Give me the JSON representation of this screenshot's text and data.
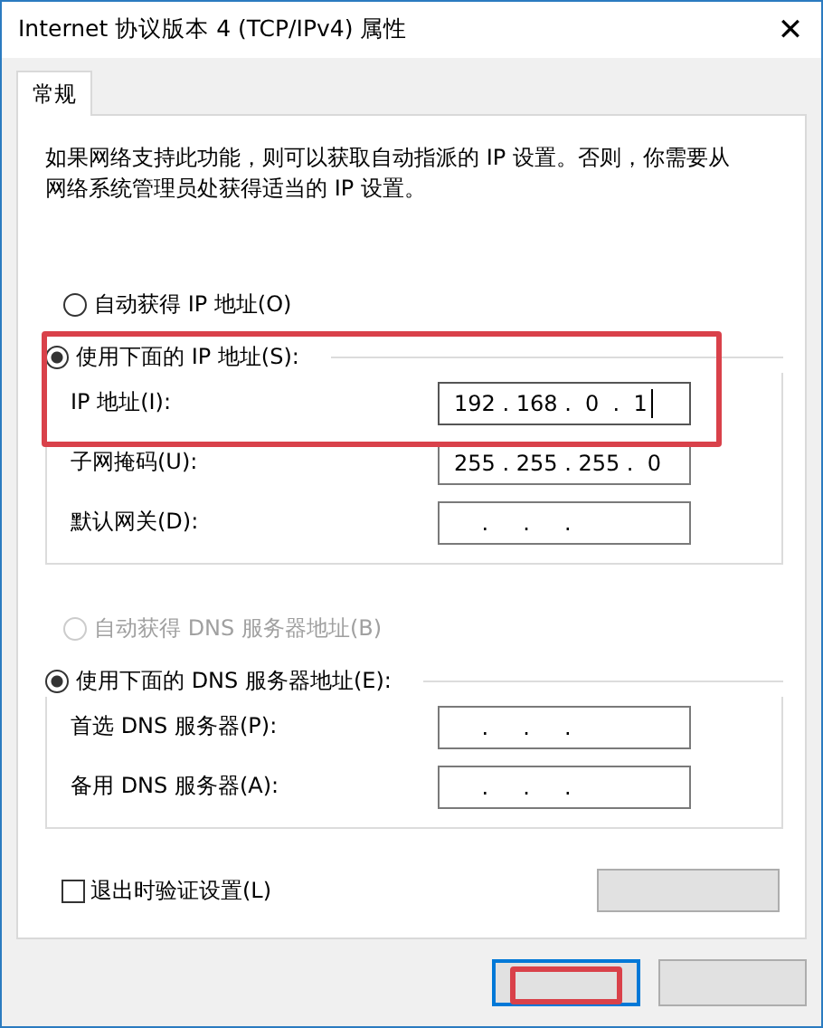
{
  "window": {
    "title": "Internet 协议版本 4 (TCP/IPv4) 属性",
    "close": "✕"
  },
  "tabs": [
    {
      "label": "常规",
      "selected": true
    }
  ],
  "description": "如果网络支持此功能，则可以获取自动指派的 IP 设置。否则，你需要从网络系统管理员处获得适当的 IP 设置。",
  "ip_section": {
    "auto_option": {
      "label": "自动获得 IP 地址(O)",
      "selected": false,
      "disabled": false
    },
    "manual_option": {
      "label": "使用下面的 IP 地址(S):",
      "selected": true
    },
    "highlighted": true,
    "fields": [
      {
        "label": "IP 地址(I):",
        "value": "192 . 168 .  0  .  1",
        "focused": true
      },
      {
        "label": "子网掩码(U):",
        "value": "255 . 255 . 255 .  0",
        "focused": false
      },
      {
        "label": "默认网关(D):",
        "value": "    .     .     .",
        "focused": false
      }
    ]
  },
  "dns_section": {
    "auto_option": {
      "label": "自动获得 DNS 服务器地址(B)",
      "selected": false,
      "disabled": true
    },
    "manual_option": {
      "label": "使用下面的 DNS 服务器地址(E):",
      "selected": true
    },
    "highlighted": false,
    "fields": [
      {
        "label": "首选 DNS 服务器(P):",
        "value": "    .     .     .",
        "focused": false
      },
      {
        "label": "备用 DNS 服务器(A):",
        "value": "    .     .     .",
        "focused": false
      }
    ]
  },
  "validate_checkbox": {
    "label": "退出时验证设置(L)",
    "checked": false
  },
  "footer_buttons": [
    {
      "default": true,
      "highlighted": true
    },
    {
      "default": false,
      "highlighted": false
    }
  ]
}
